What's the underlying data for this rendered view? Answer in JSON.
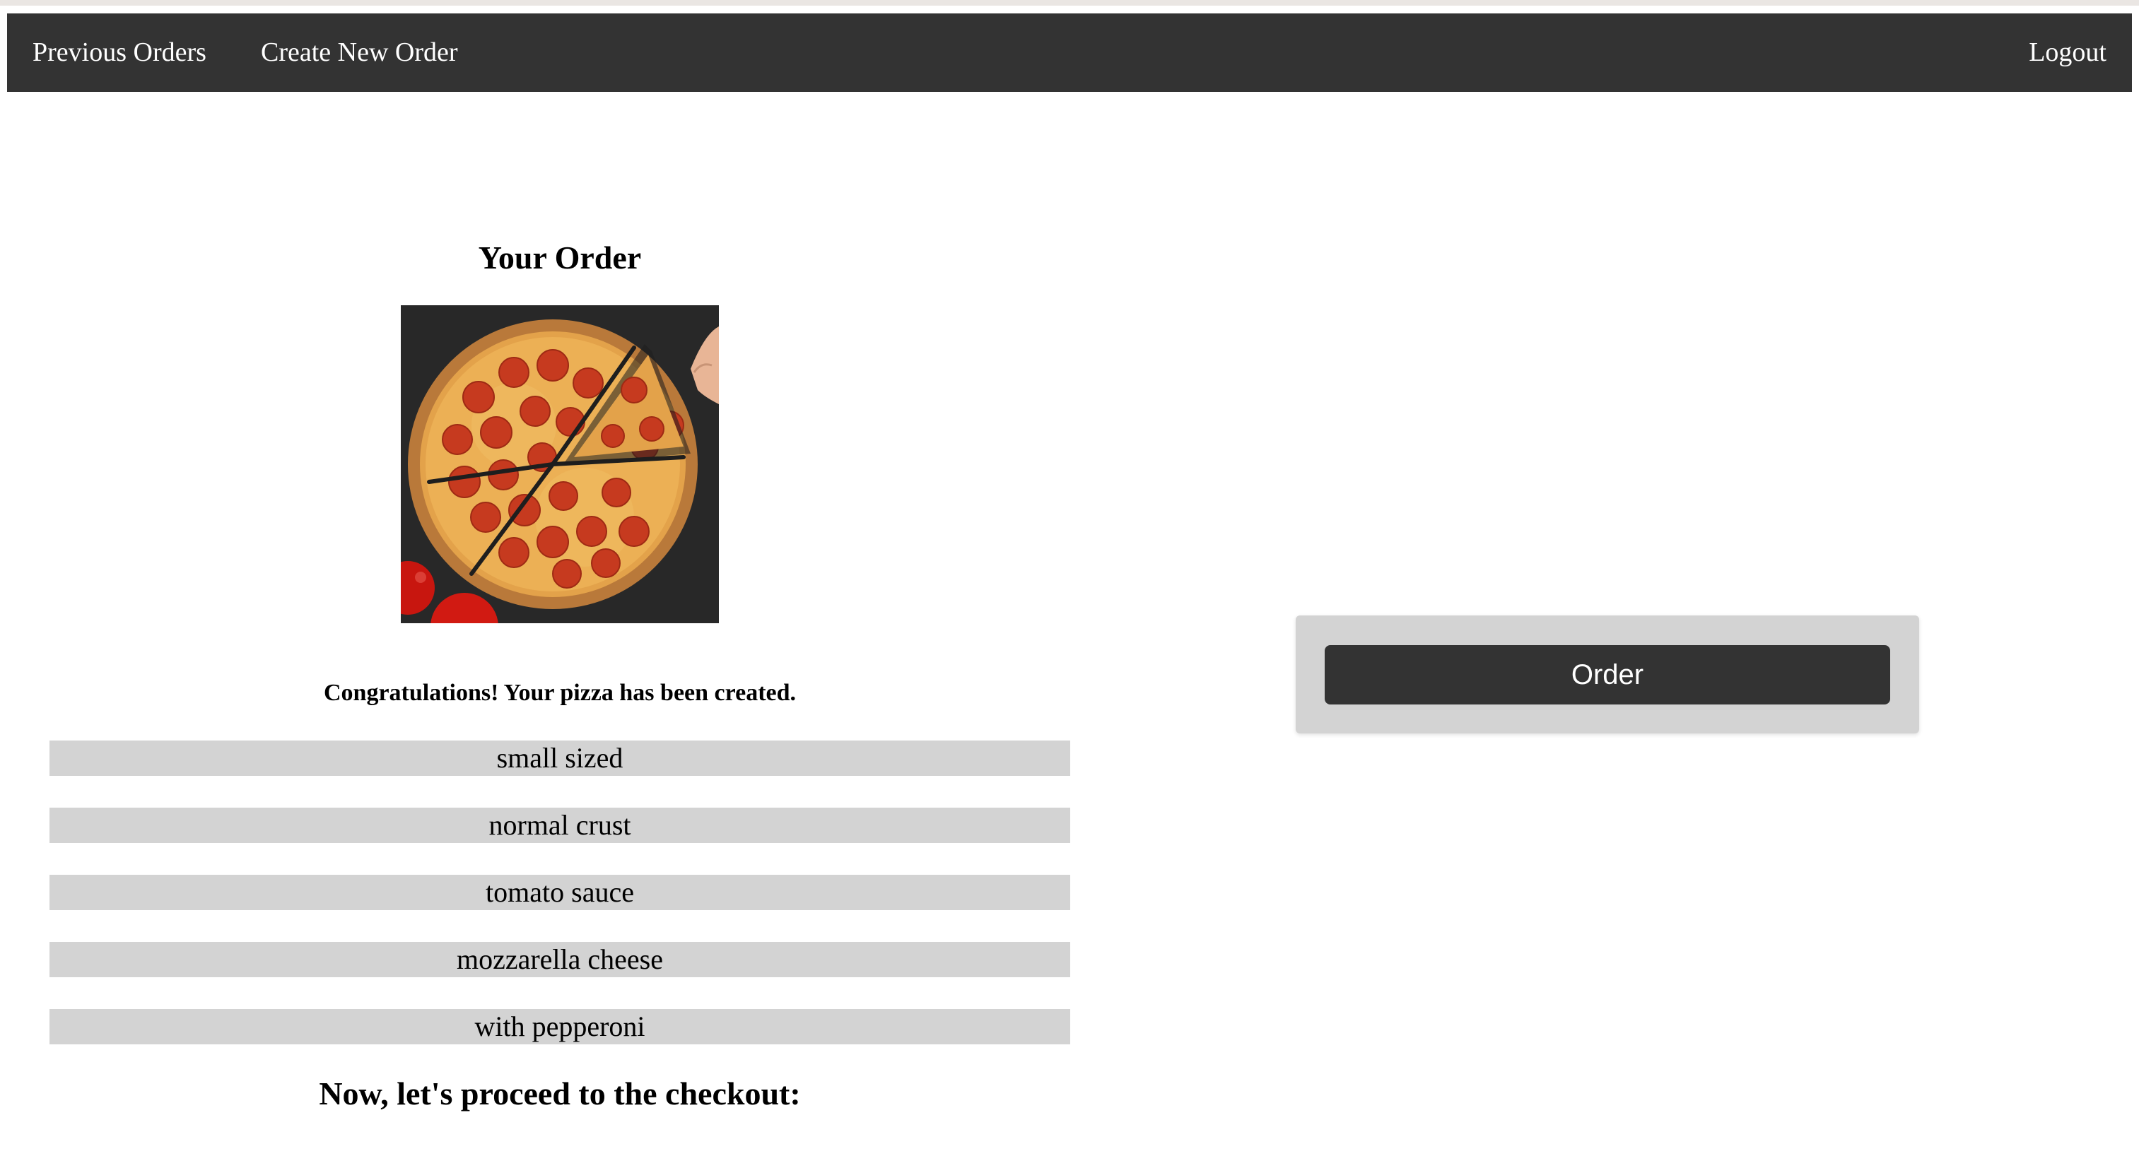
{
  "nav": {
    "previous_orders": "Previous Orders",
    "create_new_order": "Create New Order",
    "logout": "Logout"
  },
  "order": {
    "title": "Your Order",
    "image_alt": "pepperoni pizza",
    "congrats": "Congratulations! Your pizza has been created.",
    "ingredients": [
      "small sized",
      "normal crust",
      "tomato sauce",
      "mozzarella cheese",
      "with pepperoni"
    ],
    "checkout": "Now, let's proceed to the checkout:"
  },
  "checkout_panel": {
    "order_button": "Order"
  },
  "colors": {
    "navbar": "#333333",
    "panel": "#d3d3d3",
    "ingredient_bar": "#d3d3d3"
  }
}
